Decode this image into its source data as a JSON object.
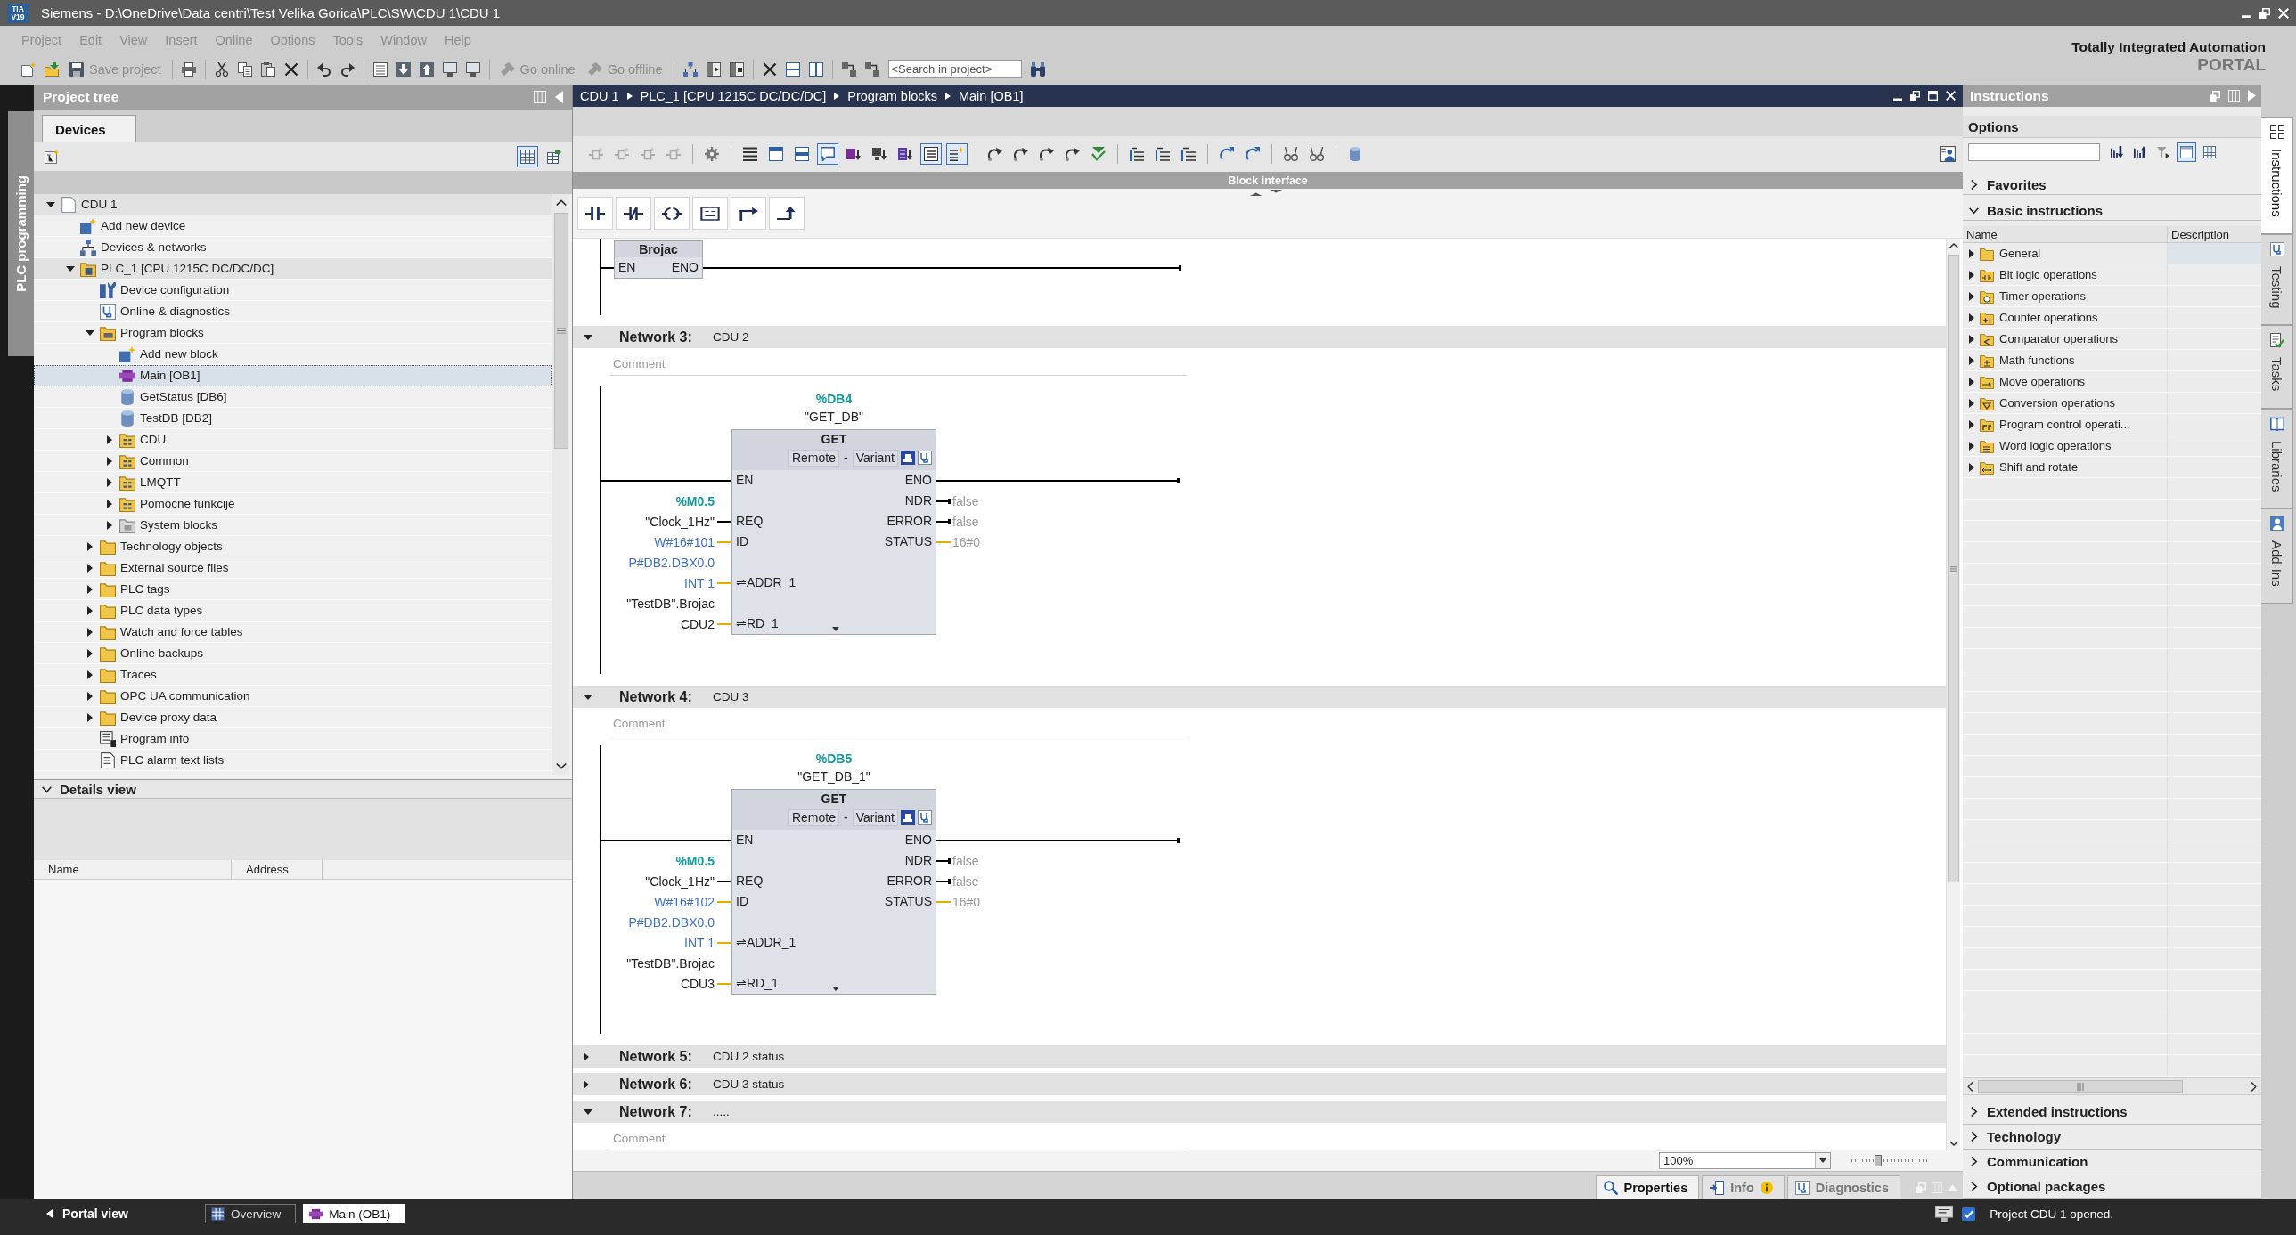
{
  "title_bar": {
    "logo": {
      "line1": "TIA",
      "line2": "V19"
    },
    "title": "Siemens - D:\\OneDrive\\Data centri\\Test Velika Gorica\\PLC\\SW\\CDU 1\\CDU 1"
  },
  "menu": [
    {
      "label": "Project",
      "disabled": true
    },
    {
      "label": "Edit",
      "disabled": true
    },
    {
      "label": "View",
      "disabled": true
    },
    {
      "label": "Insert",
      "disabled": true
    },
    {
      "label": "Online",
      "disabled": true
    },
    {
      "label": "Options",
      "disabled": true
    },
    {
      "label": "Tools",
      "disabled": true
    },
    {
      "label": "Window",
      "disabled": true
    },
    {
      "label": "Help",
      "disabled": true
    }
  ],
  "toolbar": {
    "buttons": [
      {
        "label": "Save project",
        "disabled": true
      },
      {
        "label": "Go online",
        "disabled": true
      },
      {
        "label": "Go offline",
        "disabled": true
      }
    ],
    "search": {
      "placeholder": "<Search in project>"
    }
  },
  "branding": {
    "line1": "Totally Integrated Automation",
    "line2": "PORTAL"
  },
  "side_tab": {
    "label": "PLC programming"
  },
  "project_tree": {
    "title": "Project tree",
    "tabs": [
      {
        "label": "Devices",
        "selected": true
      }
    ],
    "toolbar": [
      {
        "kind": "tree_add",
        "on": false
      },
      {
        "kind": "table",
        "on": true
      },
      {
        "kind": "table_arrow",
        "on": false
      }
    ],
    "items": [
      {
        "label": "CDU 1",
        "kind": "project",
        "expanded": true,
        "selected": false,
        "children": [
          {
            "label": "Add new device",
            "kind": "add",
            "selected": false
          },
          {
            "label": "Devices & networks",
            "kind": "network",
            "selected": false
          },
          {
            "label": "PLC_1 [CPU 1215C DC/DC/DC]",
            "kind": "plc",
            "expanded": true,
            "selected": false,
            "children": [
              {
                "label": "Device configuration",
                "kind": "config",
                "selected": false
              },
              {
                "label": "Online & diagnostics",
                "kind": "diagnostics",
                "selected": false
              },
              {
                "label": "Program blocks",
                "kind": "blocks",
                "expanded": true,
                "selected": false,
                "children": [
                  {
                    "label": "Add new block",
                    "kind": "add",
                    "selected": false
                  },
                  {
                    "label": "Main [OB1]",
                    "kind": "ob",
                    "selected": true
                  },
                  {
                    "label": "GetStatus [DB6]",
                    "kind": "db",
                    "selected": false
                  },
                  {
                    "label": "TestDB [DB2]",
                    "kind": "db",
                    "selected": false
                  },
                  {
                    "label": "CDU",
                    "kind": "group",
                    "expanded": false,
                    "selected": false
                  },
                  {
                    "label": "Common",
                    "kind": "group",
                    "expanded": false,
                    "selected": false
                  },
                  {
                    "label": "LMQTT",
                    "kind": "group",
                    "expanded": false,
                    "selected": false
                  },
                  {
                    "label": "Pomocne funkcije",
                    "kind": "group",
                    "expanded": false,
                    "selected": false
                  },
                  {
                    "label": "System blocks",
                    "kind": "system",
                    "expanded": false,
                    "selected": false
                  }
                ]
              },
              {
                "label": "Technology objects",
                "kind": "folder",
                "expanded": false,
                "selected": false
              },
              {
                "label": "External source files",
                "kind": "folder",
                "expanded": false,
                "selected": false
              },
              {
                "label": "PLC tags",
                "kind": "folder",
                "expanded": false,
                "selected": false
              },
              {
                "label": "PLC data types",
                "kind": "folder",
                "expanded": false,
                "selected": false
              },
              {
                "label": "Watch and force tables",
                "kind": "folder",
                "expanded": false,
                "selected": false
              },
              {
                "label": "Online backups",
                "kind": "folder",
                "expanded": false,
                "selected": false
              },
              {
                "label": "Traces",
                "kind": "folder",
                "expanded": false,
                "selected": false
              },
              {
                "label": "OPC UA communication",
                "kind": "folder",
                "expanded": false,
                "selected": false
              },
              {
                "label": "Device proxy data",
                "kind": "folder",
                "expanded": false,
                "selected": false
              },
              {
                "label": "Program info",
                "kind": "info",
                "selected": false
              },
              {
                "label": "PLC alarm text lists",
                "kind": "list",
                "selected": false
              }
            ]
          }
        ]
      }
    ]
  },
  "details_view": {
    "title": "Details view",
    "expanded": true,
    "columns": [
      "Name",
      "Address"
    ]
  },
  "editor": {
    "breadcrumb": [
      "CDU 1",
      "PLC_1 [CPU 1215C DC/DC/DC]",
      "Program blocks",
      "Main [OB1]"
    ],
    "toolbar": [
      [
        {
          "kind": "network",
          "on": false
        },
        {
          "kind": "network",
          "on": false
        },
        {
          "kind": "network",
          "on": false
        },
        {
          "kind": "network",
          "on": false
        }
      ],
      [
        {
          "kind": "gear",
          "on": false
        }
      ],
      [
        {
          "kind": "lines",
          "on": false
        },
        {
          "kind": "window",
          "on": false
        },
        {
          "kind": "window_bar",
          "on": false
        },
        {
          "kind": "comment",
          "on": true
        },
        {
          "kind": "block_down",
          "on": false
        },
        {
          "kind": "monitor_down",
          "on": false
        },
        {
          "kind": "list_down",
          "on": false
        },
        {
          "kind": "list_box",
          "on": true
        },
        {
          "kind": "list_star",
          "on": true
        }
      ],
      [
        {
          "kind": "curve",
          "on": false
        },
        {
          "kind": "curve",
          "on": false
        },
        {
          "kind": "curve",
          "on": false
        },
        {
          "kind": "curve",
          "on": false
        },
        {
          "kind": "check_down",
          "on": false
        }
      ],
      [
        {
          "kind": "indent",
          "on": false
        },
        {
          "kind": "indent",
          "on": false
        },
        {
          "kind": "indent",
          "on": false
        }
      ],
      [
        {
          "kind": "refresh",
          "on": false
        },
        {
          "kind": "refresh",
          "on": false
        }
      ],
      [
        {
          "kind": "glasses",
          "on": false
        },
        {
          "kind": "glasses",
          "on": false
        }
      ],
      [
        {
          "kind": "database",
          "on": false
        }
      ]
    ],
    "block_interface": "Block interface",
    "networks": [
      {
        "kind": "fragment",
        "block": {
          "type": "Brojac",
          "inputs": [
            {
              "pin": "EN",
              "kind": "power"
            }
          ],
          "outputs": [
            {
              "pin": "ENO",
              "kind": "power"
            }
          ]
        }
      },
      {
        "kind": "full",
        "number": "Network 3:",
        "title": "CDU 2",
        "expanded": true,
        "comment": {
          "placeholder": "Comment"
        },
        "block": {
          "instance_address": "%DB4",
          "instance_name": "\"GET_DB\"",
          "type": "GET",
          "mode": {
            "left": "Remote",
            "separator": "-",
            "right": "Variant"
          },
          "inputs": [
            {
              "pin": "EN",
              "kind": "power"
            },
            {
              "pin": "REQ",
              "kind": "bool",
              "operand": [
                {
                  "kind": "address",
                  "text": "%M0.5"
                },
                {
                  "kind": "symbol",
                  "text": "\"Clock_1Hz\""
                }
              ]
            },
            {
              "pin": "ID",
              "kind": "word",
              "operand": [
                {
                  "kind": "constant",
                  "text": "W#16#101"
                }
              ]
            },
            {
              "pin": "⇌ADDR_1",
              "kind": "word",
              "operand": [
                {
                  "kind": "constant",
                  "text": "P#DB2.DBX0.0"
                },
                {
                  "kind": "constant",
                  "text": "INT 1"
                }
              ]
            },
            {
              "pin": "⇌RD_1",
              "kind": "word",
              "operand": [
                {
                  "kind": "symbol",
                  "text": "\"TestDB\".Brojac"
                },
                {
                  "kind": "symbol",
                  "text": "CDU2"
                }
              ]
            }
          ],
          "outputs": [
            {
              "pin": "ENO",
              "kind": "power"
            },
            {
              "pin": "NDR",
              "kind": "bool",
              "value": "false"
            },
            {
              "pin": "ERROR",
              "kind": "bool",
              "value": "false"
            },
            {
              "pin": "STATUS",
              "kind": "word",
              "value": "16#0"
            }
          ]
        }
      },
      {
        "kind": "full",
        "number": "Network 4:",
        "title": "CDU 3",
        "expanded": true,
        "comment": {
          "placeholder": "Comment"
        },
        "block": {
          "instance_address": "%DB5",
          "instance_name": "\"GET_DB_1\"",
          "type": "GET",
          "mode": {
            "left": "Remote",
            "separator": "-",
            "right": "Variant"
          },
          "inputs": [
            {
              "pin": "EN",
              "kind": "power"
            },
            {
              "pin": "REQ",
              "kind": "bool",
              "operand": [
                {
                  "kind": "address",
                  "text": "%M0.5"
                },
                {
                  "kind": "symbol",
                  "text": "\"Clock_1Hz\""
                }
              ]
            },
            {
              "pin": "ID",
              "kind": "word",
              "operand": [
                {
                  "kind": "constant",
                  "text": "W#16#102"
                }
              ]
            },
            {
              "pin": "⇌ADDR_1",
              "kind": "word",
              "operand": [
                {
                  "kind": "constant",
                  "text": "P#DB2.DBX0.0"
                },
                {
                  "kind": "constant",
                  "text": "INT 1"
                }
              ]
            },
            {
              "pin": "⇌RD_1",
              "kind": "word",
              "operand": [
                {
                  "kind": "symbol",
                  "text": "\"TestDB\".Brojac"
                },
                {
                  "kind": "symbol",
                  "text": "CDU3"
                }
              ]
            }
          ],
          "outputs": [
            {
              "pin": "ENO",
              "kind": "power"
            },
            {
              "pin": "NDR",
              "kind": "bool",
              "value": "false"
            },
            {
              "pin": "ERROR",
              "kind": "bool",
              "value": "false"
            },
            {
              "pin": "STATUS",
              "kind": "word",
              "value": "16#0"
            }
          ]
        }
      },
      {
        "kind": "full",
        "number": "Network 5:",
        "title": "CDU 2 status",
        "expanded": false
      },
      {
        "kind": "full",
        "number": "Network 6:",
        "title": "CDU 3 status",
        "expanded": false
      },
      {
        "kind": "full",
        "number": "Network 7:",
        "title": ".....",
        "expanded": true,
        "comment": {
          "placeholder": "Comment"
        }
      }
    ],
    "zoom": {
      "value": "100%"
    },
    "zoom_slider": {
      "level": 0.35
    },
    "inspector_tabs": [
      {
        "label": "Properties",
        "kind": "properties",
        "selected": true
      },
      {
        "label": "Info",
        "kind": "info",
        "selected": false
      },
      {
        "label": "Diagnostics",
        "kind": "diagnostics",
        "selected": false
      }
    ]
  },
  "instructions": {
    "title": "Instructions",
    "options": "Options",
    "toolbar": [
      {
        "kind": "sort_down",
        "on": false
      },
      {
        "kind": "sort_up",
        "on": false
      },
      {
        "kind": "filter",
        "on": false
      },
      {
        "kind": "panel",
        "on": true
      },
      {
        "kind": "table",
        "on": false
      }
    ],
    "sections": [
      {
        "label": "Favorites",
        "expanded": false
      },
      {
        "label": "Basic instructions",
        "expanded": true
      }
    ],
    "columns": [
      "Name",
      "Description"
    ],
    "items": [
      {
        "label": "General",
        "kind": "general",
        "expanded": false,
        "selected": true
      },
      {
        "label": "Bit logic operations",
        "kind": "bit",
        "expanded": false,
        "selected": false
      },
      {
        "label": "Timer operations",
        "kind": "timer",
        "expanded": false,
        "selected": false
      },
      {
        "label": "Counter operations",
        "kind": "counter",
        "expanded": false,
        "selected": false
      },
      {
        "label": "Comparator operations",
        "kind": "comparator",
        "expanded": false,
        "selected": false
      },
      {
        "label": "Math functions",
        "kind": "math",
        "expanded": false,
        "selected": false
      },
      {
        "label": "Move operations",
        "kind": "move",
        "expanded": false,
        "selected": false
      },
      {
        "label": "Conversion operations",
        "kind": "conversion",
        "expanded": false,
        "selected": false
      },
      {
        "label": "Program control operati...",
        "kind": "program",
        "expanded": false,
        "selected": false
      },
      {
        "label": "Word logic operations",
        "kind": "word",
        "expanded": false,
        "selected": false
      },
      {
        "label": "Shift and rotate",
        "kind": "shift",
        "expanded": false,
        "selected": false
      }
    ],
    "more_sections": [
      {
        "label": "Extended instructions",
        "expanded": false
      },
      {
        "label": "Technology",
        "expanded": false
      },
      {
        "label": "Communication",
        "expanded": false
      },
      {
        "label": "Optional packages",
        "expanded": false
      }
    ]
  },
  "side_tabs": [
    {
      "label": "Instructions",
      "kind": "instructions",
      "selected": true
    },
    {
      "label": "Testing",
      "kind": "testing",
      "selected": false
    },
    {
      "label": "Tasks",
      "kind": "tasks",
      "selected": false
    },
    {
      "label": "Libraries",
      "kind": "libraries",
      "selected": false
    },
    {
      "label": "Add-Ins",
      "kind": "addins",
      "selected": false
    }
  ],
  "status_bar": {
    "portal_view": "Portal view",
    "tabs": [
      {
        "label": "Overview",
        "kind": "overview",
        "selected": false
      },
      {
        "label": "Main (OB1)",
        "kind": "block",
        "selected": true
      }
    ],
    "message": "Project CDU 1 opened."
  }
}
